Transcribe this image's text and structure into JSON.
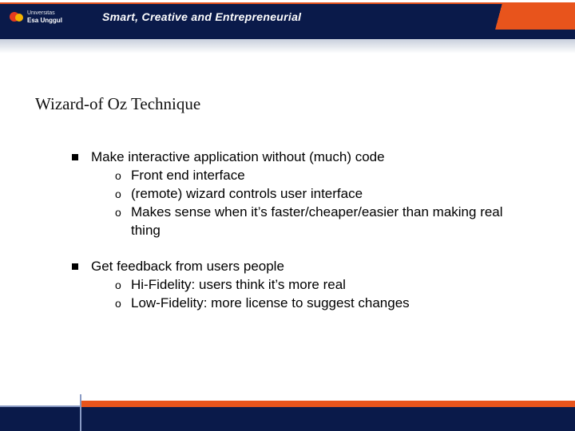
{
  "header": {
    "brand_top": "Universitas",
    "brand_name": "Esa Unggul",
    "tagline": "Smart, Creative and Entrepreneurial"
  },
  "title": "Wizard-of Oz Technique",
  "bullets": [
    {
      "text": "Make interactive application without (much) code",
      "sub": [
        "Front end interface",
        "(remote) wizard controls user interface",
        "Makes sense when it’s faster/cheaper/easier than making real thing"
      ]
    },
    {
      "text": "Get feedback from users people",
      "sub": [
        "Hi-Fidelity: users think it’s more real",
        "Low-Fidelity: more license to suggest changes"
      ]
    }
  ]
}
